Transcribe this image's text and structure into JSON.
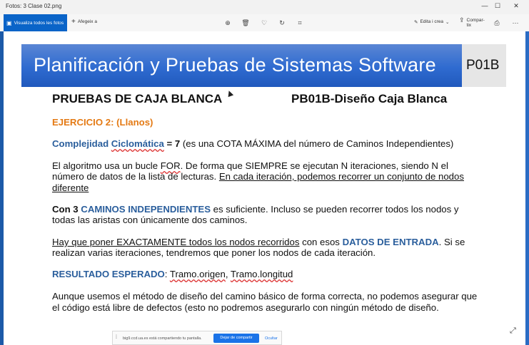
{
  "window": {
    "title": "Fotos: 3 Clase 02.png",
    "minimize": "—",
    "maximize": "☐",
    "close": "✕"
  },
  "toolbar": {
    "all_photos": "Visualiza todos les fotos",
    "add_to": "Afegeix a",
    "edit_create": "Edita i crea",
    "share": "Compar-\ntix",
    "icons": [
      "zoom-icon",
      "delete-icon",
      "favorite-icon",
      "rotate-icon",
      "crop-icon",
      "print-icon",
      "more-icon"
    ]
  },
  "slide": {
    "banner_title": "Planificación y Pruebas de Sistemas Software",
    "banner_code": "P01B",
    "heading_left": "PRUEBAS DE CAJA BLANCA",
    "heading_right": "PB01B-Diseño Caja Blanca",
    "exercise": "EJERCICIO 2:  (Llanos)",
    "complexity_label_1": "Complejidad ",
    "complexity_label_2": "Ciclomática",
    "complexity_value": " = 7",
    "complexity_note": " (es una COTA MÁXIMA del número de Caminos Independientes)",
    "algo_line1_a": "El algoritmo usa un bucle ",
    "algo_line1_b": "FOR",
    "algo_line1_c": ". De forma que SIEMPRE se ejecutan N iteraciones, siendo N el",
    "algo_line2_a": "número de datos de la lista de lecturas. ",
    "algo_line2_b": "En cada iteración, podemos recorrer un conjunto de nodos",
    "algo_line3": "diferente",
    "con3_a": "Con 3 ",
    "con3_b": "CAMINOS INDEPENDIENTES",
    "con3_c": " es suficiente. Incluso se pueden recorrer todos los nodos y",
    "con3_line2": "todas las aristas con únicamente dos caminos.",
    "hay_a": "Hay que poner EXACTAMENTE todos los nodos recorridos",
    "hay_b": " con esos ",
    "hay_c": "DATOS DE ENTRADA",
    "hay_d": ". Si se",
    "hay_line2": "realizan varias iteraciones, tendremos que poner los nodos de cada iteración.",
    "result_label": "RESULTADO ESPERADO",
    "result_colon": ": ",
    "result_a": "Tramo.origen",
    "result_sep": ", ",
    "result_b": "Tramo.longitud",
    "aunque_line1": "Aunque usemos el método de diseño del camino básico de forma correcta, no podemos asegurar que",
    "aunque_line2": "el código está libre de defectos (esto no podremos asegurarlo con ningún método de diseño."
  },
  "share_bar": {
    "text": "big9.ccd.ua.es está compartiendo tu pantalla.",
    "stop": "Dejar de compartir",
    "hide": "Ocultar"
  },
  "colors": {
    "accent": "#0a64c8",
    "banner": "#2f6bd0",
    "orange": "#e47a14",
    "blue_text": "#2a5e9c"
  }
}
